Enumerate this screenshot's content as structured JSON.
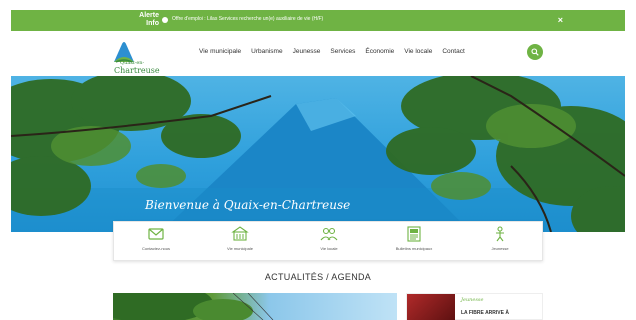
{
  "alert": {
    "label_line1": "Alerte",
    "label_line2": "Info",
    "text": "Offre d'emploi : Lilas Services recherche un(e) auxiliaire de vie (H/F)",
    "close": "×"
  },
  "logo": {
    "line1": "Quaix-en-",
    "line2": "Chartreuse"
  },
  "nav": {
    "items": [
      "Vie municipale",
      "Urbanisme",
      "Jeunesse",
      "Services",
      "Économie",
      "Vie locale",
      "Contact"
    ]
  },
  "hero": {
    "title": "Bienvenue à Quaix-en-Chartreuse"
  },
  "quick_links": [
    {
      "label": "Contactez-nous",
      "icon": "mail-icon"
    },
    {
      "label": "Vie municipale",
      "icon": "town-hall-icon"
    },
    {
      "label": "Vie locale",
      "icon": "people-icon"
    },
    {
      "label": "Bulletins municipaux",
      "icon": "newsletter-icon"
    },
    {
      "label": "Jeunesse",
      "icon": "children-icon"
    }
  ],
  "section": {
    "title": "ACTUALITÉS / AGENDA"
  },
  "news": {
    "category": "Jeunesse",
    "headline": "LA FIBRE ARRIVE À"
  },
  "colors": {
    "accent": "#6fb344",
    "sky": "#2fa0dc"
  }
}
